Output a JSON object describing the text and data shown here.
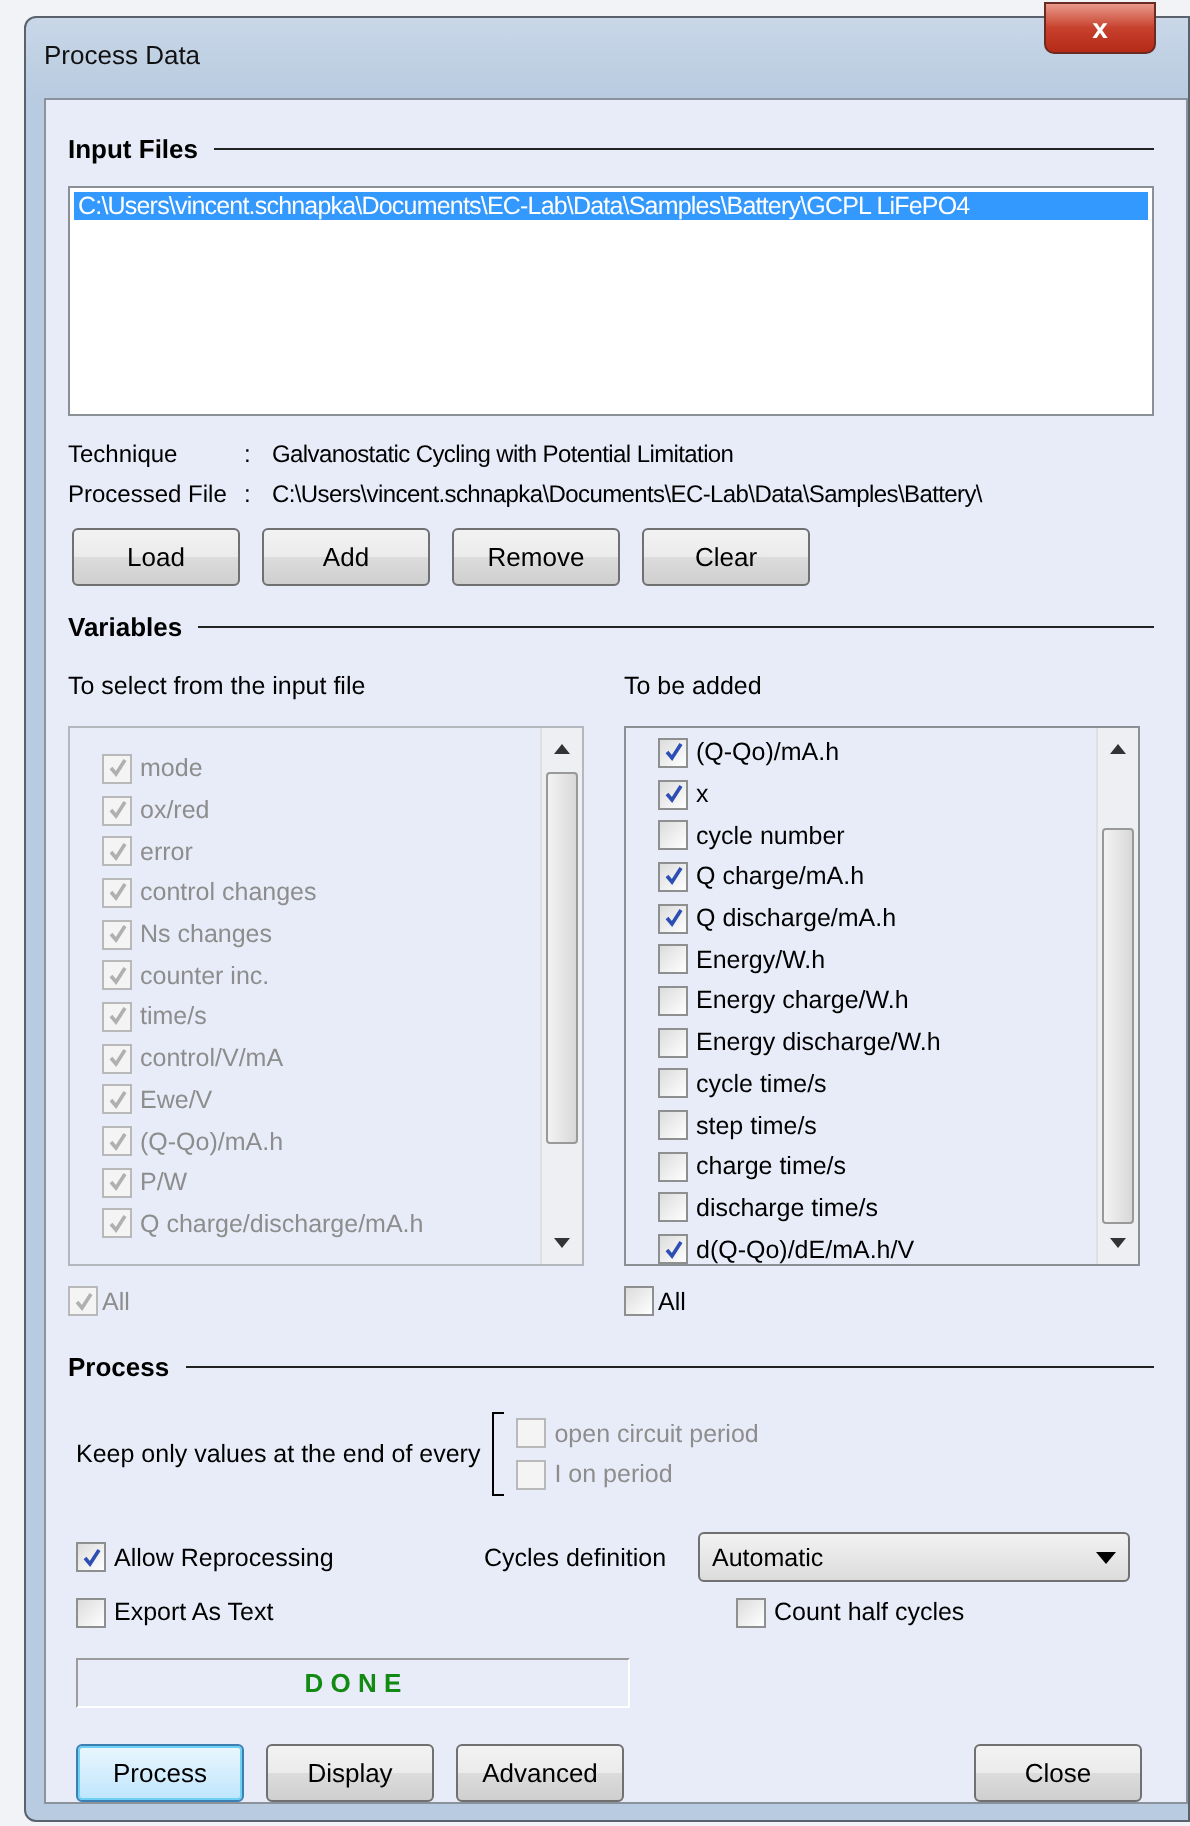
{
  "window": {
    "title": "Process Data",
    "close": "x"
  },
  "input_files": {
    "heading": "Input Files",
    "files": [
      {
        "path": "C:\\Users\\vincent.schnapka\\Documents\\EC-Lab\\Data\\Samples\\Battery\\GCPL LiFePO4",
        "selected": true
      }
    ],
    "info": [
      {
        "label": "Technique",
        "sep": ":",
        "value": "Galvanostatic Cycling with Potential Limitation"
      },
      {
        "label": "Processed File",
        "sep": ":",
        "value": "C:\\Users\\vincent.schnapka\\Documents\\EC-Lab\\Data\\Samples\\Battery\\"
      }
    ],
    "buttons": [
      "Load",
      "Add",
      "Remove",
      "Clear"
    ]
  },
  "variables": {
    "heading": "Variables",
    "lists": [
      {
        "title": "To select from the input file",
        "disabled": true,
        "all": {
          "label": "All",
          "checked": true
        },
        "items": [
          {
            "label": "mode",
            "checked": true
          },
          {
            "label": "ox/red",
            "checked": true
          },
          {
            "label": "error",
            "checked": true
          },
          {
            "label": "control changes",
            "checked": true
          },
          {
            "label": "Ns changes",
            "checked": true
          },
          {
            "label": "counter inc.",
            "checked": true
          },
          {
            "label": "time/s",
            "checked": true
          },
          {
            "label": "control/V/mA",
            "checked": true
          },
          {
            "label": "Ewe/V",
            "checked": true
          },
          {
            "label": "(Q-Qo)/mA.h",
            "checked": true
          },
          {
            "label": "P/W",
            "checked": true
          },
          {
            "label": "Q charge/discharge/mA.h",
            "checked": true
          }
        ]
      },
      {
        "title": "To be added",
        "disabled": false,
        "all": {
          "label": "All",
          "checked": false
        },
        "items": [
          {
            "label": "(Q-Qo)/mA.h",
            "checked": true
          },
          {
            "label": "x",
            "checked": true
          },
          {
            "label": "cycle number",
            "checked": false
          },
          {
            "label": "Q charge/mA.h",
            "checked": true
          },
          {
            "label": "Q discharge/mA.h",
            "checked": true
          },
          {
            "label": "Energy/W.h",
            "checked": false
          },
          {
            "label": "Energy charge/W.h",
            "checked": false
          },
          {
            "label": "Energy discharge/W.h",
            "checked": false
          },
          {
            "label": "cycle time/s",
            "checked": false
          },
          {
            "label": "step time/s",
            "checked": false
          },
          {
            "label": "charge time/s",
            "checked": false
          },
          {
            "label": "discharge time/s",
            "checked": false
          },
          {
            "label": "d(Q-Qo)/dE/mA.h/V",
            "checked": true
          }
        ]
      }
    ]
  },
  "process": {
    "heading": "Process",
    "keep_label": "Keep only values at the end of every",
    "keep_options": [
      {
        "label": "open circuit period",
        "checked": false,
        "disabled": true
      },
      {
        "label": "I on period",
        "checked": false,
        "disabled": true
      }
    ],
    "allow_reprocessing": {
      "label": "Allow Reprocessing",
      "checked": true
    },
    "export_as_text": {
      "label": "Export As Text",
      "checked": false
    },
    "cycles_definition": {
      "label": "Cycles definition",
      "value": "Automatic"
    },
    "count_half_cycles": {
      "label": "Count half cycles",
      "checked": false
    },
    "status": "D O N E"
  },
  "buttons": [
    {
      "label": "Process",
      "selected": true
    },
    {
      "label": "Display",
      "selected": false
    },
    {
      "label": "Advanced",
      "selected": false
    },
    {
      "label": "Close",
      "selected": false
    }
  ]
}
